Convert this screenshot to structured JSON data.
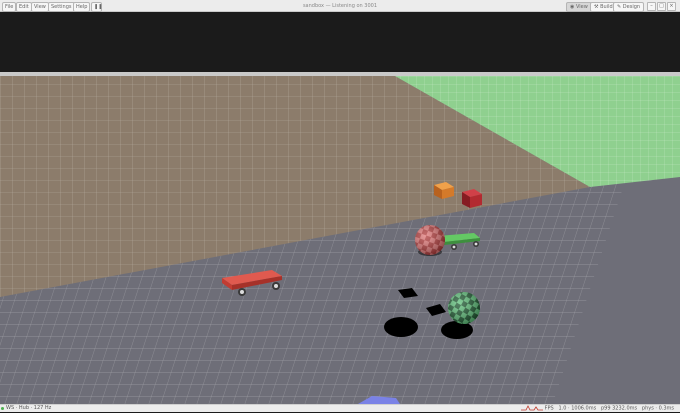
{
  "menu": {
    "file": "File",
    "edit": "Edit",
    "view": "View",
    "settings": "Settings",
    "help": "Help"
  },
  "window": {
    "title": "sandbox — Listening on 3001"
  },
  "modes": {
    "view": "View",
    "build": "Build",
    "design": "Design"
  },
  "status": {
    "left_text": "WS · Hub · 127 Hz",
    "fps_label": "FPS",
    "fps_value": "1.0 · 1006.0ms",
    "p99": "p99 3232.0ms",
    "phys": "phys · 0.3ms"
  },
  "colors": {
    "sky": "#1b1b1b",
    "horizon": "#bfbfbf",
    "floor_brown": "#8c7c6b",
    "floor_gray": "#6e6e78",
    "floor_green": "#8fd08f",
    "red_cart": "#d9493f",
    "green_cart": "#5fc15f",
    "orange_box": "#d47a2a",
    "red_box": "#b22a30",
    "ball_red": "#d65a5a",
    "ball_green": "#2f7a45",
    "blue_pad": "#7a82e6"
  }
}
